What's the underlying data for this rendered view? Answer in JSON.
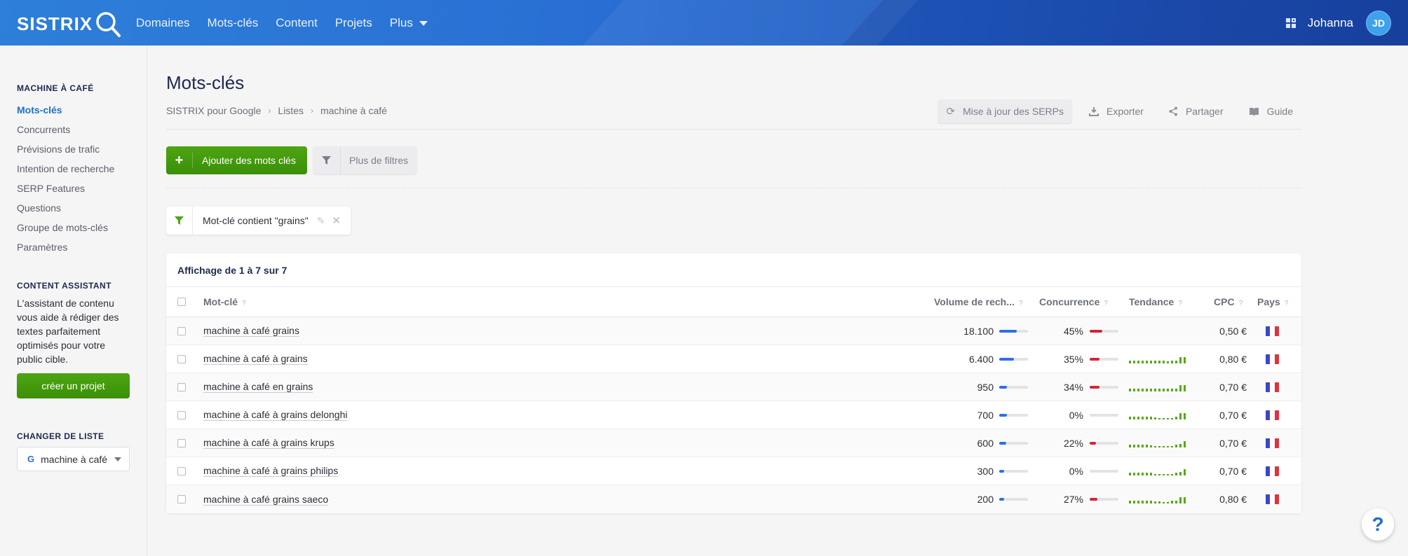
{
  "brand": "SISTRIX",
  "nav": {
    "items": [
      "Domaines",
      "Mots-clés",
      "Content",
      "Projets"
    ],
    "more": "Plus"
  },
  "user": {
    "name": "Johanna",
    "initials": "JD"
  },
  "sidebar": {
    "list_heading": "MACHINE À CAFÉ",
    "items": [
      {
        "label": "Mots-clés",
        "active": true
      },
      {
        "label": "Concurrents"
      },
      {
        "label": "Prévisions de trafic"
      },
      {
        "label": "Intention de recherche"
      },
      {
        "label": "SERP Features"
      },
      {
        "label": "Questions"
      },
      {
        "label": "Groupe de mots-clés"
      },
      {
        "label": "Paramètres"
      }
    ],
    "assistant_heading": "CONTENT ASSISTANT",
    "assistant_text": "L'assistant de contenu vous aide à rédiger des textes parfaitement optimisés pour votre public cible.",
    "create_button": "créer un projet",
    "change_heading": "CHANGER DE LISTE",
    "list_select": "machine à café",
    "list_select_icon": "G"
  },
  "main": {
    "title": "Mots-clés",
    "breadcrumb": [
      "SISTRIX pour Google",
      "Listes",
      "machine à café"
    ],
    "actions": {
      "update": "Mise à jour des SERPs",
      "export": "Exporter",
      "share": "Partager",
      "guide": "Guide"
    },
    "add_button": "Ajouter des mots clés",
    "filter_button": "Plus de filtres",
    "active_filter": "Mot-clé contient \"grains\""
  },
  "table": {
    "summary": "Affichage de 1 à 7 sur 7",
    "columns": {
      "keyword": "Mot-clé",
      "volume": "Volume de rech...",
      "competition": "Concurrence",
      "trend": "Tendance",
      "cpc": "CPC",
      "country": "Pays"
    },
    "help_glyph": "?",
    "rows": [
      {
        "keyword": "machine à café grains",
        "volume": "18.100",
        "volume_level": 0.62,
        "competition": "45%",
        "competition_level": 0.45,
        "trend": [],
        "cpc": "0,50 €",
        "country": "FR"
      },
      {
        "keyword": "machine à café à grains",
        "volume": "6.400",
        "volume_level": 0.5,
        "competition": "35%",
        "competition_level": 0.35,
        "trend": [
          4,
          4,
          4,
          4,
          4,
          4,
          4,
          4,
          4,
          3,
          4,
          4,
          9,
          9
        ],
        "cpc": "0,80 €",
        "country": "FR"
      },
      {
        "keyword": "machine à café en grains",
        "volume": "950",
        "volume_level": 0.28,
        "competition": "34%",
        "competition_level": 0.34,
        "trend": [
          4,
          4,
          4,
          4,
          4,
          4,
          4,
          4,
          4,
          4,
          4,
          4,
          9,
          9
        ],
        "cpc": "0,70 €",
        "country": "FR"
      },
      {
        "keyword": "machine à café à grains delonghi",
        "volume": "700",
        "volume_level": 0.26,
        "competition": "0%",
        "competition_level": 0,
        "trend": [
          4,
          4,
          4,
          4,
          4,
          4,
          3,
          2,
          2,
          2,
          2,
          4,
          9,
          9
        ],
        "cpc": "0,70 €",
        "country": "FR"
      },
      {
        "keyword": "machine à café à grains krups",
        "volume": "600",
        "volume_level": 0.24,
        "competition": "22%",
        "competition_level": 0.22,
        "trend": [
          4,
          4,
          4,
          4,
          4,
          3,
          2,
          2,
          2,
          2,
          2,
          4,
          5,
          9
        ],
        "cpc": "0,70 €",
        "country": "FR"
      },
      {
        "keyword": "machine à café à grains philips",
        "volume": "300",
        "volume_level": 0.18,
        "competition": "0%",
        "competition_level": 0,
        "trend": [
          4,
          4,
          4,
          4,
          4,
          4,
          2,
          2,
          2,
          2,
          2,
          4,
          5,
          9
        ],
        "cpc": "0,70 €",
        "country": "FR"
      },
      {
        "keyword": "machine à café grains saeco",
        "volume": "200",
        "volume_level": 0.16,
        "competition": "27%",
        "competition_level": 0.27,
        "trend": [
          4,
          4,
          4,
          4,
          4,
          4,
          3,
          3,
          2,
          2,
          4,
          4,
          9,
          9
        ],
        "cpc": "0,80 €",
        "country": "FR"
      }
    ]
  },
  "colors": {
    "accent_blue": "#1f6fd3",
    "primary_green": "#3a8f08",
    "volume_bar": "#2f6fe4",
    "competition_bar": "#d0283a",
    "trend_bar": "#5aa713",
    "flag": [
      "#3b47c4",
      "#ffffff",
      "#e0323f"
    ]
  }
}
